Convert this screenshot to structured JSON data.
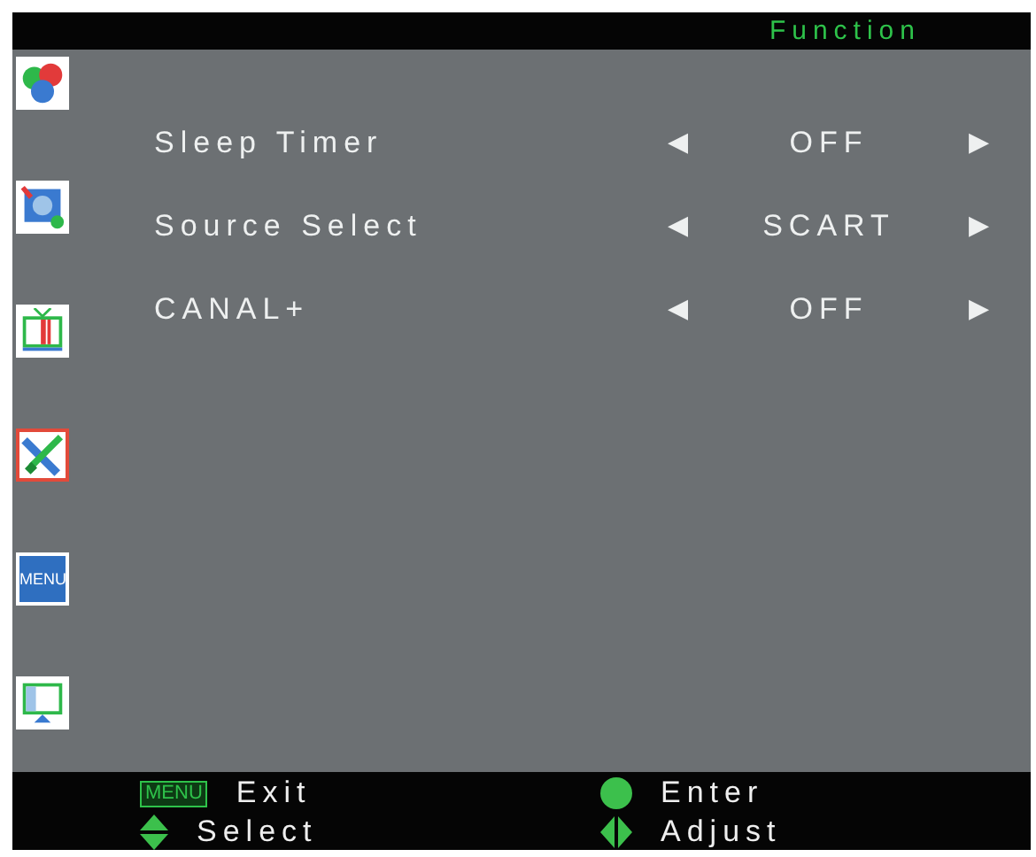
{
  "header": {
    "title": "Function"
  },
  "sidebar": {
    "items": [
      {
        "kind": "rgb",
        "selected": false
      },
      {
        "kind": "disc",
        "selected": false
      },
      {
        "kind": "tv",
        "selected": false
      },
      {
        "kind": "tools",
        "selected": true
      },
      {
        "kind": "menu",
        "text": "MENU",
        "selected": false
      },
      {
        "kind": "monitor",
        "selected": false
      }
    ]
  },
  "settings": [
    {
      "label": "Sleep Timer",
      "left": "◀",
      "value": "OFF",
      "right": "▶"
    },
    {
      "label": "Source Select",
      "left": "◀",
      "value": "SCART",
      "right": "▶"
    },
    {
      "label": "CANAL+",
      "left": "◀",
      "value": "OFF",
      "right": "▶"
    }
  ],
  "footer": {
    "hints": [
      {
        "kind": "menu-key",
        "key": "MENU",
        "label": "Exit"
      },
      {
        "kind": "dot",
        "label": "Enter"
      },
      {
        "kind": "updown",
        "label": "Select"
      },
      {
        "kind": "leftright",
        "label": "Adjust"
      }
    ]
  }
}
